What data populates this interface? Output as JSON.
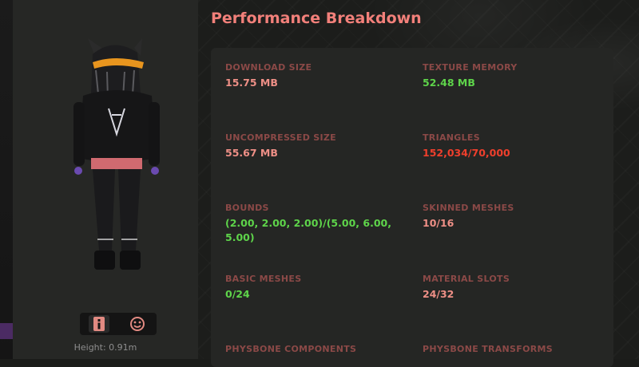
{
  "title": "Performance Breakdown",
  "avatar": {
    "height_label": "Height: 0.91m"
  },
  "icons": [
    {
      "name": "info-icon"
    },
    {
      "name": "smile-face-icon"
    }
  ],
  "stats": {
    "download_size": {
      "label": "DOWNLOAD SIZE",
      "value": "15.75 MB",
      "color": "#ee8f86"
    },
    "texture_memory": {
      "label": "TEXTURE MEMORY",
      "value": "52.48 MB",
      "color": "#5ed44a"
    },
    "uncompressed_size": {
      "label": "UNCOMPRESSED SIZE",
      "value": "55.67 MB",
      "color": "#ee8f86"
    },
    "triangles": {
      "label": "TRIANGLES",
      "value": "152,034/70,000",
      "color": "#ef3f2c"
    },
    "bounds": {
      "label": "BOUNDS",
      "value": "(2.00, 2.00, 2.00)/(5.00, 6.00, 5.00)",
      "color": "#5ed44a"
    },
    "skinned_meshes": {
      "label": "SKINNED MESHES",
      "value": "10/16",
      "color": "#ee8f86"
    },
    "basic_meshes": {
      "label": "BASIC MESHES",
      "value": "0/24",
      "color": "#5ed44a"
    },
    "material_slots": {
      "label": "MATERIAL SLOTS",
      "value": "24/32",
      "color": "#ee8f86"
    },
    "physbone_components": {
      "label": "PHYSBONE COMPONENTS",
      "value": ""
    },
    "physbone_transforms": {
      "label": "PHYSBONE TRANSFORMS",
      "value": ""
    }
  }
}
